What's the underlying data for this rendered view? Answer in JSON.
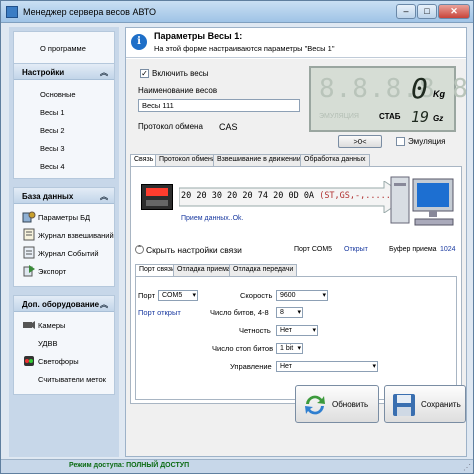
{
  "window": {
    "title": "Менеджер сервера весов АВТО",
    "min": "–",
    "max": "□",
    "close": "✕"
  },
  "nav": {
    "top_link": "О программе",
    "sections": [
      {
        "title": "Настройки",
        "items": [
          "Основные",
          "Весы 1",
          "Весы 2",
          "Весы 3",
          "Весы 4"
        ]
      },
      {
        "title": "База данных",
        "items": [
          "Параметры БД",
          "Журнал взвешиваний",
          "Журнал Событий",
          "Экспорт"
        ]
      },
      {
        "title": "Доп. оборудование",
        "items": [
          "Камеры",
          "УДВВ",
          "Светофоры",
          "Считыватели меток"
        ]
      }
    ]
  },
  "banner": {
    "title": "Параметры Весы 1:",
    "subtitle": "На этой форме настраиваются параметры \"Весы 1\""
  },
  "form": {
    "enable_label": "Включить весы",
    "enable_checked": true,
    "name_label": "Наименование весов",
    "name_value": "Весы 111",
    "protocol_label": "Протокол обмена",
    "protocol_value": "CAS"
  },
  "lcd": {
    "ghost": "8.8.8.8.8",
    "weight": "0",
    "weight_unit": "Kg",
    "emulation_label": "ЭМУЛЯЦИЯ",
    "stable_label": "СТАБ",
    "secondary": "19",
    "secondary_unit": "Gz"
  },
  "zero_button": ">0<",
  "emulation_check": "Эмуляция",
  "tabs": [
    "Связь",
    "Протокол обмена",
    "Взвешивание в движении",
    "Обработка данных"
  ],
  "comm": {
    "stream_hex": "20 20 30 20 20 74 20 0D 0A",
    "stream_open": "(",
    "stream_ascii": "ST,GS,-,.......",
    "stream_close": ")",
    "received": "Прием данных..Ok.",
    "hide_link": "Скрыть настройки связи",
    "port_label": "Порт COM5",
    "port_status": "Открыт",
    "buffer_label": "Буфер приема",
    "buffer_value": "1024"
  },
  "subtabs": [
    "Порт связи",
    "Отладка приема",
    "Отладка передачи"
  ],
  "port": {
    "port_label": "Порт",
    "port_value": "COM5",
    "port_open": "Порт открыт",
    "speed_label": "Скорость",
    "speed_value": "9600",
    "bits_label": "Число битов, 4-8",
    "bits_value": "8",
    "parity_label": "Четность",
    "parity_value": "Нет",
    "stop_label": "Число стоп битов",
    "stop_value": "1 bit",
    "flow_label": "Управление",
    "flow_value": "Нет"
  },
  "buttons": {
    "refresh": "Обновить",
    "save": "Сохранить"
  },
  "status": {
    "text": "Режим доступа: ПОЛНЫЙ ДОСТУП"
  },
  "colors": {
    "accent": "#1e6fc8",
    "nav_bg": "#c7d7e9",
    "status_green": "#0b6b12",
    "led_red": "#ff3d2e"
  }
}
